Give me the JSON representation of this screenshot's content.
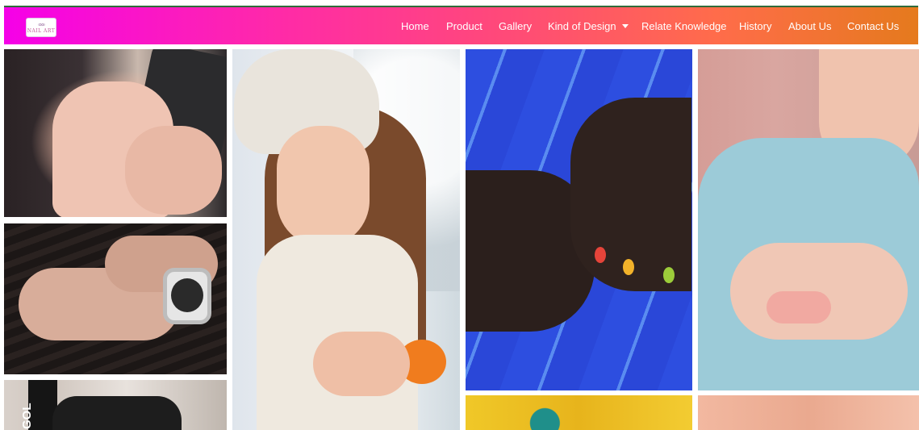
{
  "brand": {
    "logo_text": "NAIL ART",
    "logo_mark": "◦∞◦"
  },
  "nav": {
    "items": [
      {
        "label": "Home"
      },
      {
        "label": "Product"
      },
      {
        "label": "Gallery"
      },
      {
        "label": "Kind of Design",
        "dropdown": true
      },
      {
        "label": "Relate Knowledge"
      },
      {
        "label": "History"
      },
      {
        "label": "About Us"
      },
      {
        "label": "Contact Us"
      }
    ]
  },
  "gallery": {
    "photos": [
      {
        "subject": "hands with dark nails holding phone"
      },
      {
        "subject": "hands with black nails and wristwatch"
      },
      {
        "subject": "tattooed shoulder with black top",
        "visible_text": "GOL"
      },
      {
        "subject": "smiling woman in knit hat peeling orange"
      },
      {
        "subject": "hands with colorful nail art on blue"
      },
      {
        "subject": "yellow textured background"
      },
      {
        "subject": "woman in blue blazer holding macarons"
      },
      {
        "subject": "peach background with plants"
      }
    ]
  },
  "colors": {
    "nav_gradient_start": "#f500e8",
    "nav_gradient_end": "#e57a1d",
    "nav_text": "#ffffff",
    "top_rule": "#2f6b3a"
  }
}
